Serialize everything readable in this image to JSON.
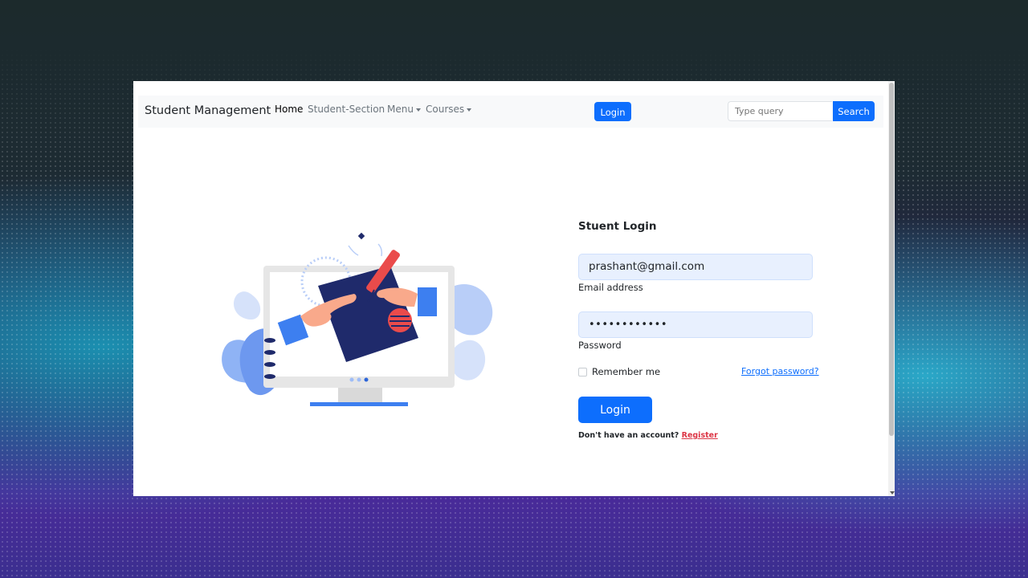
{
  "navbar": {
    "brand": "Student Management",
    "links": [
      {
        "label": "Home",
        "active": true
      },
      {
        "label": "Student-Section",
        "active": false
      },
      {
        "label": "Menu",
        "dropdown": true
      },
      {
        "label": "Courses",
        "dropdown": true
      }
    ],
    "login_button": "Login",
    "search": {
      "placeholder": "Type query",
      "button": "Search"
    }
  },
  "login_form": {
    "title": "Stuent Login",
    "email": {
      "value": "prashant@gmail.com",
      "label": "Email address"
    },
    "password": {
      "value": "••••••••••••",
      "label": "Password"
    },
    "remember_me": {
      "label": "Remember me",
      "checked": false
    },
    "forgot_password": "Forgot password?",
    "submit": "Login",
    "register_prompt": "Don't have an account?",
    "register_link": "Register"
  },
  "colors": {
    "primary": "#0d6efd",
    "register": "#dc3545",
    "navbar_bg": "#f8f9fa",
    "input_bg": "#e8f0fe"
  },
  "icons": {
    "illustration": "laptop-hands-pen-illustration"
  }
}
